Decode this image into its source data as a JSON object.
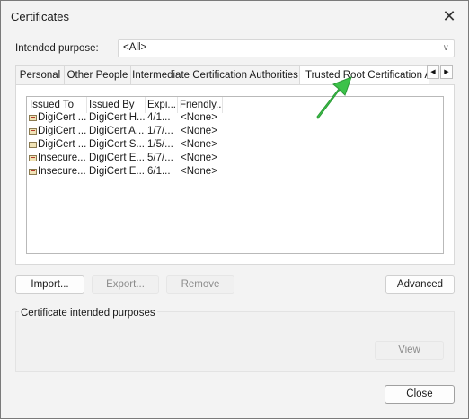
{
  "window": {
    "title": "Certificates",
    "close_glyph": "✕"
  },
  "purpose": {
    "label": "Intended purpose:",
    "value": "<All>"
  },
  "tabs": [
    {
      "label": "Personal"
    },
    {
      "label": "Other People"
    },
    {
      "label": "Intermediate Certification Authorities"
    },
    {
      "label": "Trusted Root Certification A"
    }
  ],
  "table": {
    "columns": [
      "Issued To",
      "Issued By",
      "Expi...",
      "Friendly..."
    ],
    "rows": [
      [
        "DigiCert ...",
        "DigiCert H...",
        "4/1...",
        "<None>"
      ],
      [
        "DigiCert ...",
        "DigiCert A...",
        "1/7/...",
        "<None>"
      ],
      [
        "DigiCert ...",
        "DigiCert S...",
        "1/5/...",
        "<None>"
      ],
      [
        "Insecure....",
        "DigiCert E...",
        "5/7/...",
        "<None>"
      ],
      [
        "Insecure....",
        "DigiCert E...",
        "6/1...",
        "<None>"
      ]
    ]
  },
  "buttons": {
    "import": "Import...",
    "export": "Export...",
    "remove": "Remove",
    "advanced": "Advanced",
    "view": "View",
    "close": "Close"
  },
  "purposes_group": {
    "label": "Certificate intended purposes"
  },
  "colors": {
    "annotation_arrow": "#3cc24a"
  }
}
